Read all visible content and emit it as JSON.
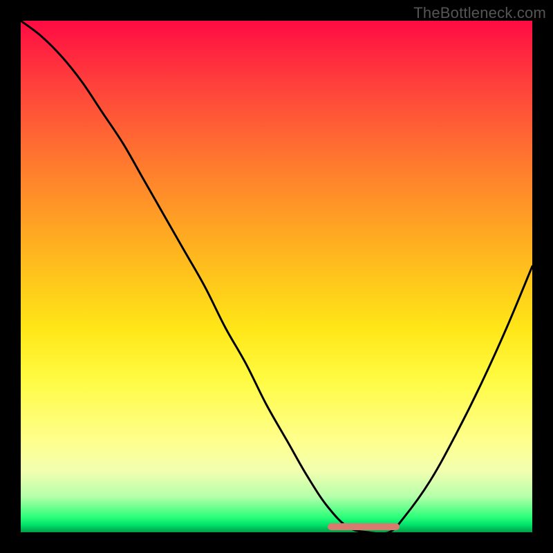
{
  "attribution": "TheBottleneck.com",
  "colors": {
    "frame": "#000000",
    "curve_stroke": "#000000",
    "tolerance_bar": "#d97a6e",
    "attribution_text": "#555555"
  },
  "chart_data": {
    "type": "line",
    "title": "",
    "xlabel": "",
    "ylabel": "",
    "xlim": [
      0,
      100
    ],
    "ylim": [
      0,
      100
    ],
    "grid": false,
    "legend": false,
    "background_gradient": {
      "direction": "vertical",
      "stops": [
        {
          "pos": 0,
          "color": "#ff0b43"
        },
        {
          "pos": 12,
          "color": "#ff3f3c"
        },
        {
          "pos": 28,
          "color": "#ff7a2e"
        },
        {
          "pos": 45,
          "color": "#ffb41f"
        },
        {
          "pos": 60,
          "color": "#ffe617"
        },
        {
          "pos": 70,
          "color": "#fffb42"
        },
        {
          "pos": 82,
          "color": "#ffff8c"
        },
        {
          "pos": 88,
          "color": "#f2ffb0"
        },
        {
          "pos": 93,
          "color": "#b6ffaa"
        },
        {
          "pos": 97,
          "color": "#2dff7a"
        },
        {
          "pos": 98.5,
          "color": "#00e46b"
        },
        {
          "pos": 99.2,
          "color": "#00c35a"
        },
        {
          "pos": 100,
          "color": "#00a048"
        }
      ]
    },
    "series": [
      {
        "name": "bottleneck-curve",
        "x": [
          0,
          4,
          8,
          12,
          16,
          20,
          24,
          28,
          32,
          36,
          40,
          44,
          48,
          52,
          56,
          60,
          64,
          68,
          72,
          75,
          80,
          85,
          90,
          95,
          100
        ],
        "y": [
          100,
          97,
          93,
          88,
          82,
          76,
          69,
          62,
          55,
          48,
          40,
          33,
          25,
          18,
          11,
          5,
          1,
          0,
          0,
          3,
          10,
          19,
          29,
          40,
          52
        ]
      }
    ],
    "annotations": {
      "tolerance_region": {
        "x_start": 60,
        "x_end": 74,
        "y": 0
      }
    }
  }
}
